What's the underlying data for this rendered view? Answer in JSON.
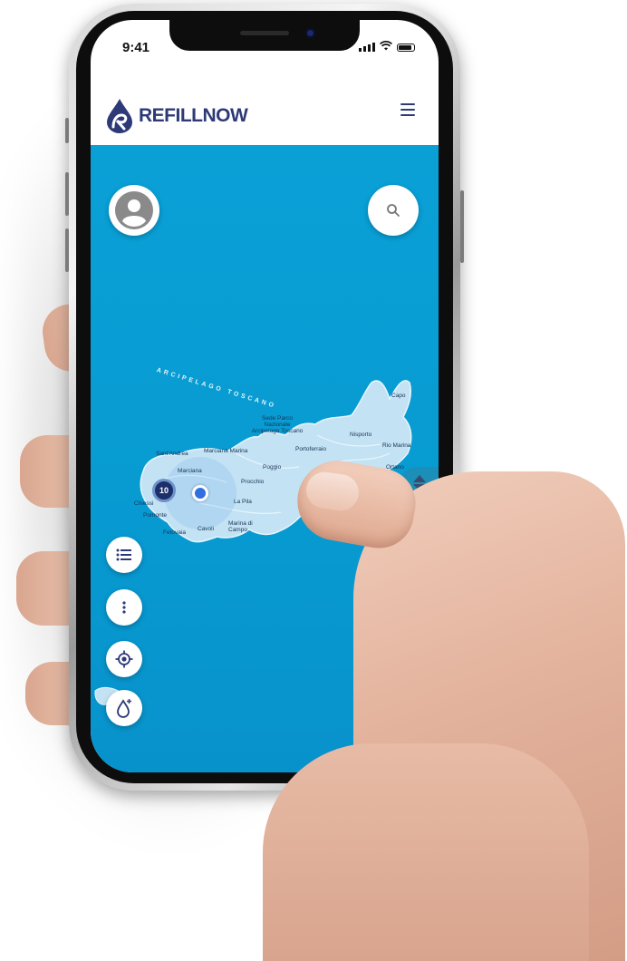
{
  "status_bar": {
    "time": "9:41"
  },
  "app": {
    "brand": "REFILLNOW"
  },
  "map": {
    "archipelago_label": "ARCIPELAGO TOSCANO",
    "cluster_count": "10",
    "places": [
      "Capo",
      "Sede Parco Nazionale Arcipelago Toscano",
      "Portoferraio",
      "Nisporto",
      "Rio Marina",
      "Sant'Andrea",
      "Marciana",
      "Marciana Marina",
      "Procchio",
      "Ortano",
      "Poggio",
      "Chiessi",
      "Pomonte",
      "La Pila",
      "Marina di Campo",
      "Cavoli",
      "Fetovaia"
    ]
  },
  "icons": {
    "profile": "user-circle-icon",
    "search": "search-icon",
    "list": "list-icon",
    "more": "more-vertical-icon",
    "locate": "crosshair-icon",
    "refill": "water-drop-icon",
    "menu": "hamburger-menu-icon"
  },
  "colors": {
    "brand": "#2e3a78",
    "sea": "#0aa0d6",
    "island": "#bfe0f2",
    "marker": "#2f6fe0",
    "cluster": "#1c2f6b"
  }
}
